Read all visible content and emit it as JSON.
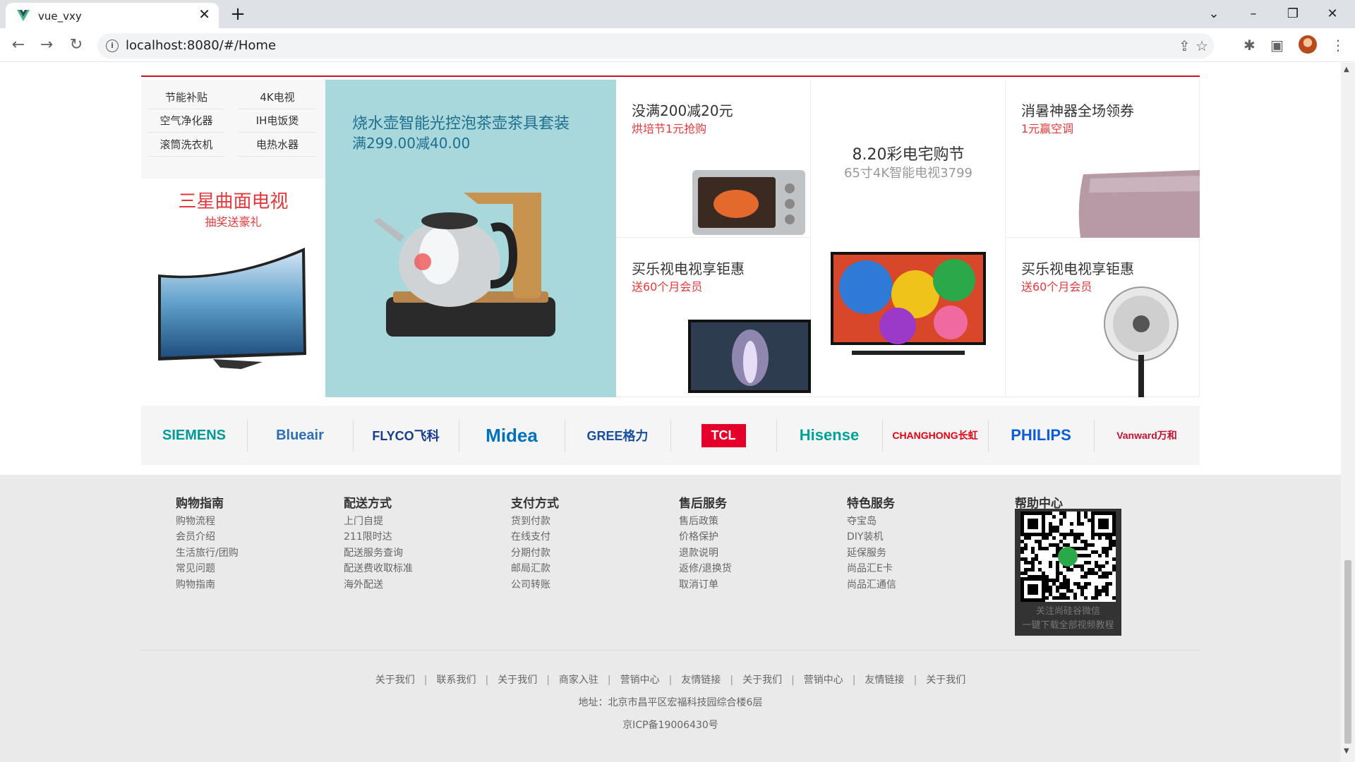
{
  "browser": {
    "tab_title": "vue_vxy",
    "url": "localhost:8080/#/Home",
    "new_tab": "+",
    "close": "✕"
  },
  "section": {
    "keywords": [
      "节能补贴",
      "4K电视",
      "空气净化器",
      "IH电饭煲",
      "滚筒洗衣机",
      "电热水器"
    ],
    "left_promo": {
      "title": "三星曲面电视",
      "sub": "抽奖送豪礼"
    },
    "feature": {
      "title": "烧水壶智能光控泡茶壶茶具套装",
      "sub": "满299.00减40.00"
    },
    "cells": [
      {
        "title": "没满200减20元",
        "sub": "烘培节1元抢购"
      },
      {
        "title": "8.20彩电宅购节",
        "sub": "65寸4K智能电视3799"
      },
      {
        "title": "消暑神器全场领券",
        "sub": "1元赢空调"
      },
      {
        "title": "买乐视电视享钜惠",
        "sub": "送60个月会员"
      },
      {
        "title": "买乐视电视享钜惠",
        "sub": "送60个月会员"
      }
    ]
  },
  "brands": [
    {
      "name": "SIEMENS",
      "color": "#009999"
    },
    {
      "name": "Blueair",
      "color": "#2d6fb7"
    },
    {
      "name": "FLYCO飞科",
      "color": "#1a3c8c"
    },
    {
      "name": "Midea",
      "color": "#0072bc"
    },
    {
      "name": "GREE格力",
      "color": "#1b4fa0"
    },
    {
      "name": "TCL",
      "color": "#e4002b"
    },
    {
      "name": "Hisense",
      "color": "#00a19a"
    },
    {
      "name": "CHANGHONG长虹",
      "color": "#e60012"
    },
    {
      "name": "PHILIPS",
      "color": "#0b5ed7"
    },
    {
      "name": "Vanward万和",
      "color": "#c8102e"
    }
  ],
  "footer": {
    "columns": [
      {
        "title": "购物指南",
        "items": [
          "购物流程",
          "会员介绍",
          "生活旅行/团购",
          "常见问题",
          "购物指南"
        ]
      },
      {
        "title": "配送方式",
        "items": [
          "上门自提",
          "211限时达",
          "配送服务查询",
          "配送费收取标准",
          "海外配送"
        ]
      },
      {
        "title": "支付方式",
        "items": [
          "货到付款",
          "在线支付",
          "分期付款",
          "邮局汇款",
          "公司转账"
        ]
      },
      {
        "title": "售后服务",
        "items": [
          "售后政策",
          "价格保护",
          "退款说明",
          "返修/退换货",
          "取消订单"
        ]
      },
      {
        "title": "特色服务",
        "items": [
          "夺宝岛",
          "DIY装机",
          "延保服务",
          "尚品汇E卡",
          "尚品汇通信"
        ]
      },
      {
        "title": "帮助中心",
        "items": []
      }
    ],
    "qr_text": [
      "关注尚硅谷微信",
      "一键下载全部视频教程"
    ],
    "links": [
      "关于我们",
      "联系我们",
      "关于我们",
      "商家入驻",
      "营销中心",
      "友情链接",
      "关于我们",
      "营销中心",
      "友情链接",
      "关于我们"
    ],
    "address": "地址：北京市昌平区宏福科技园综合楼6层",
    "icp": "京ICP备19006430号"
  }
}
